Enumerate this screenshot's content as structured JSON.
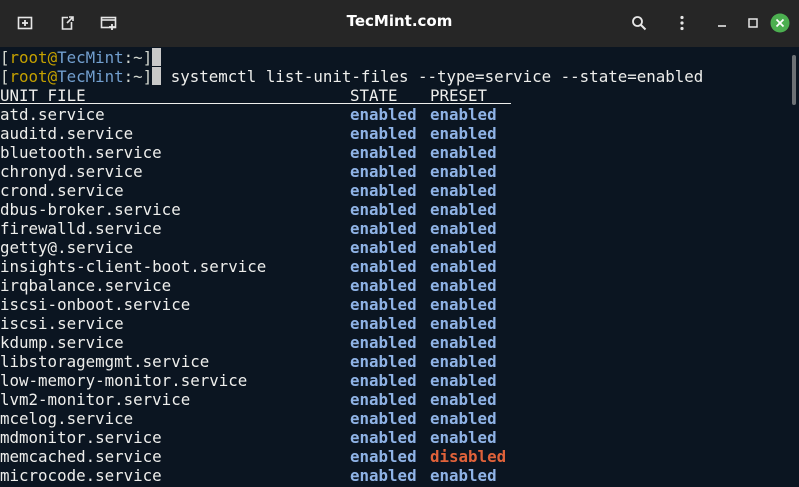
{
  "window": {
    "title": "TecMint.com",
    "close_color": "#4caf50",
    "icons": {
      "new_tab": "new-tab-icon",
      "detach": "detach-tab-icon",
      "new_window": "new-window-icon",
      "search": "search-icon",
      "menu": "kebab-menu-icon",
      "minimize": "minimize-icon",
      "maximize": "maximize-icon",
      "close": "close-icon"
    }
  },
  "terminal": {
    "prompt": {
      "open": "[",
      "user": "root",
      "at": "@",
      "host": "TecMint",
      "path": ":~",
      "close": "]"
    },
    "command": "systemctl list-unit-files --type=service --state=enabled",
    "header": {
      "unit": "UNIT FILE",
      "state": "STATE",
      "preset": "PRESET"
    },
    "rows": [
      {
        "unit": "atd.service",
        "state": "enabled",
        "preset": "enabled"
      },
      {
        "unit": "auditd.service",
        "state": "enabled",
        "preset": "enabled"
      },
      {
        "unit": "bluetooth.service",
        "state": "enabled",
        "preset": "enabled"
      },
      {
        "unit": "chronyd.service",
        "state": "enabled",
        "preset": "enabled"
      },
      {
        "unit": "crond.service",
        "state": "enabled",
        "preset": "enabled"
      },
      {
        "unit": "dbus-broker.service",
        "state": "enabled",
        "preset": "enabled"
      },
      {
        "unit": "firewalld.service",
        "state": "enabled",
        "preset": "enabled"
      },
      {
        "unit": "getty@.service",
        "state": "enabled",
        "preset": "enabled"
      },
      {
        "unit": "insights-client-boot.service",
        "state": "enabled",
        "preset": "enabled"
      },
      {
        "unit": "irqbalance.service",
        "state": "enabled",
        "preset": "enabled"
      },
      {
        "unit": "iscsi-onboot.service",
        "state": "enabled",
        "preset": "enabled"
      },
      {
        "unit": "iscsi.service",
        "state": "enabled",
        "preset": "enabled"
      },
      {
        "unit": "kdump.service",
        "state": "enabled",
        "preset": "enabled"
      },
      {
        "unit": "libstoragemgmt.service",
        "state": "enabled",
        "preset": "enabled"
      },
      {
        "unit": "low-memory-monitor.service",
        "state": "enabled",
        "preset": "enabled"
      },
      {
        "unit": "lvm2-monitor.service",
        "state": "enabled",
        "preset": "enabled"
      },
      {
        "unit": "mcelog.service",
        "state": "enabled",
        "preset": "enabled"
      },
      {
        "unit": "mdmonitor.service",
        "state": "enabled",
        "preset": "enabled"
      },
      {
        "unit": "memcached.service",
        "state": "enabled",
        "preset": "disabled"
      },
      {
        "unit": "microcode.service",
        "state": "enabled",
        "preset": "enabled"
      }
    ]
  }
}
